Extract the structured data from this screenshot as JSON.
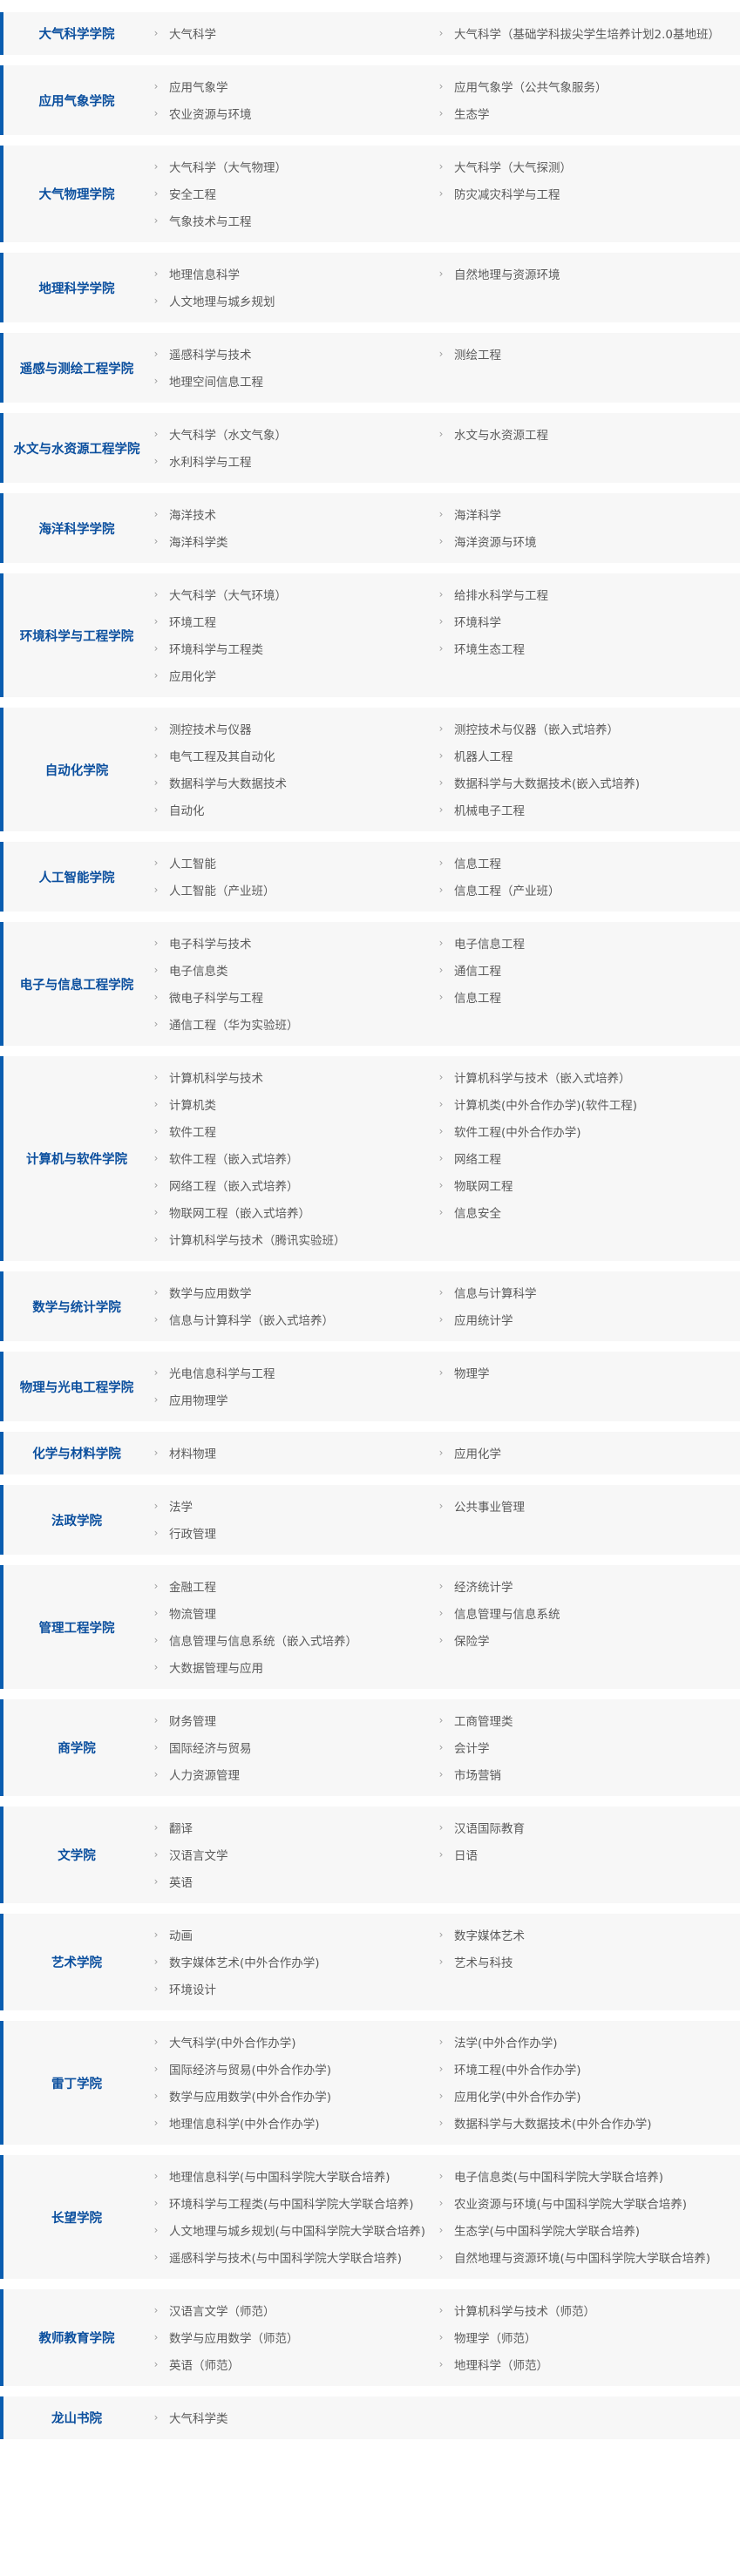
{
  "colleges": [
    {
      "name": "大气科学学院",
      "majors": [
        "大气科学",
        "大气科学（基础学科拔尖学生培养计划2.0基地班）"
      ]
    },
    {
      "name": "应用气象学院",
      "majors": [
        "应用气象学",
        "应用气象学（公共气象服务）",
        "农业资源与环境",
        "生态学"
      ]
    },
    {
      "name": "大气物理学院",
      "majors": [
        "大气科学（大气物理）",
        "大气科学（大气探测）",
        "安全工程",
        "防灾减灾科学与工程",
        "气象技术与工程"
      ]
    },
    {
      "name": "地理科学学院",
      "majors": [
        "地理信息科学",
        "自然地理与资源环境",
        "人文地理与城乡规划"
      ]
    },
    {
      "name": "遥感与测绘工程学院",
      "majors": [
        "遥感科学与技术",
        "测绘工程",
        "地理空间信息工程"
      ]
    },
    {
      "name": "水文与水资源工程学院",
      "majors": [
        "大气科学（水文气象）",
        "水文与水资源工程",
        "水利科学与工程"
      ]
    },
    {
      "name": "海洋科学学院",
      "majors": [
        "海洋技术",
        "海洋科学",
        "海洋科学类",
        "海洋资源与环境"
      ]
    },
    {
      "name": "环境科学与工程学院",
      "majors": [
        "大气科学（大气环境）",
        "给排水科学与工程",
        "环境工程",
        "环境科学",
        "环境科学与工程类",
        "环境生态工程",
        "应用化学"
      ]
    },
    {
      "name": "自动化学院",
      "majors": [
        "测控技术与仪器",
        "测控技术与仪器（嵌入式培养）",
        "电气工程及其自动化",
        "机器人工程",
        "数据科学与大数据技术",
        "数据科学与大数据技术(嵌入式培养)",
        "自动化",
        "机械电子工程"
      ]
    },
    {
      "name": "人工智能学院",
      "majors": [
        "人工智能",
        "信息工程",
        "人工智能（产业班）",
        "信息工程（产业班）"
      ]
    },
    {
      "name": "电子与信息工程学院",
      "majors": [
        "电子科学与技术",
        "电子信息工程",
        "电子信息类",
        "通信工程",
        "微电子科学与工程",
        "信息工程",
        "通信工程（华为实验班）"
      ]
    },
    {
      "name": "计算机与软件学院",
      "majors": [
        "计算机科学与技术",
        "计算机科学与技术（嵌入式培养）",
        "计算机类",
        "计算机类(中外合作办学)(软件工程)",
        "软件工程",
        "软件工程(中外合作办学)",
        "软件工程（嵌入式培养）",
        "网络工程",
        "网络工程（嵌入式培养）",
        "物联网工程",
        "物联网工程（嵌入式培养）",
        "信息安全",
        "计算机科学与技术（腾讯实验班）"
      ]
    },
    {
      "name": "数学与统计学院",
      "majors": [
        "数学与应用数学",
        "信息与计算科学",
        "信息与计算科学（嵌入式培养）",
        "应用统计学"
      ]
    },
    {
      "name": "物理与光电工程学院",
      "majors": [
        "光电信息科学与工程",
        "物理学",
        "应用物理学"
      ]
    },
    {
      "name": "化学与材料学院",
      "majors": [
        "材料物理",
        "应用化学"
      ]
    },
    {
      "name": "法政学院",
      "majors": [
        "法学",
        "公共事业管理",
        "行政管理"
      ]
    },
    {
      "name": "管理工程学院",
      "majors": [
        "金融工程",
        "经济统计学",
        "物流管理",
        "信息管理与信息系统",
        "信息管理与信息系统（嵌入式培养）",
        "保险学",
        "大数据管理与应用"
      ]
    },
    {
      "name": "商学院",
      "majors": [
        "财务管理",
        "工商管理类",
        "国际经济与贸易",
        "会计学",
        "人力资源管理",
        "市场营销"
      ]
    },
    {
      "name": "文学院",
      "majors": [
        "翻译",
        "汉语国际教育",
        "汉语言文学",
        "日语",
        "英语"
      ]
    },
    {
      "name": "艺术学院",
      "majors": [
        "动画",
        "数字媒体艺术",
        "数字媒体艺术(中外合作办学)",
        "艺术与科技",
        "环境设计"
      ]
    },
    {
      "name": "雷丁学院",
      "majors": [
        "大气科学(中外合作办学)",
        "法学(中外合作办学)",
        "国际经济与贸易(中外合作办学)",
        "环境工程(中外合作办学)",
        "数学与应用数学(中外合作办学)",
        "应用化学(中外合作办学)",
        "地理信息科学(中外合作办学)",
        "数据科学与大数据技术(中外合作办学)"
      ]
    },
    {
      "name": "长望学院",
      "majors": [
        "地理信息科学(与中国科学院大学联合培养)",
        "电子信息类(与中国科学院大学联合培养)",
        "环境科学与工程类(与中国科学院大学联合培养)",
        "农业资源与环境(与中国科学院大学联合培养)",
        "人文地理与城乡规划(与中国科学院大学联合培养)",
        "生态学(与中国科学院大学联合培养)",
        "遥感科学与技术(与中国科学院大学联合培养)",
        "自然地理与资源环境(与中国科学院大学联合培养)"
      ]
    },
    {
      "name": "教师教育学院",
      "majors": [
        "汉语言文学（师范）",
        "计算机科学与技术（师范）",
        "数学与应用数学（师范）",
        "物理学（师范）",
        "英语（师范）",
        "地理科学（师范）"
      ]
    },
    {
      "name": "龙山书院",
      "majors": [
        "大气科学类"
      ]
    }
  ],
  "bullet_glyph": "›",
  "accent_color": "#0a5db0",
  "college_text_color": "#0b4f9e",
  "row_bg_color": "#f7f7f7"
}
